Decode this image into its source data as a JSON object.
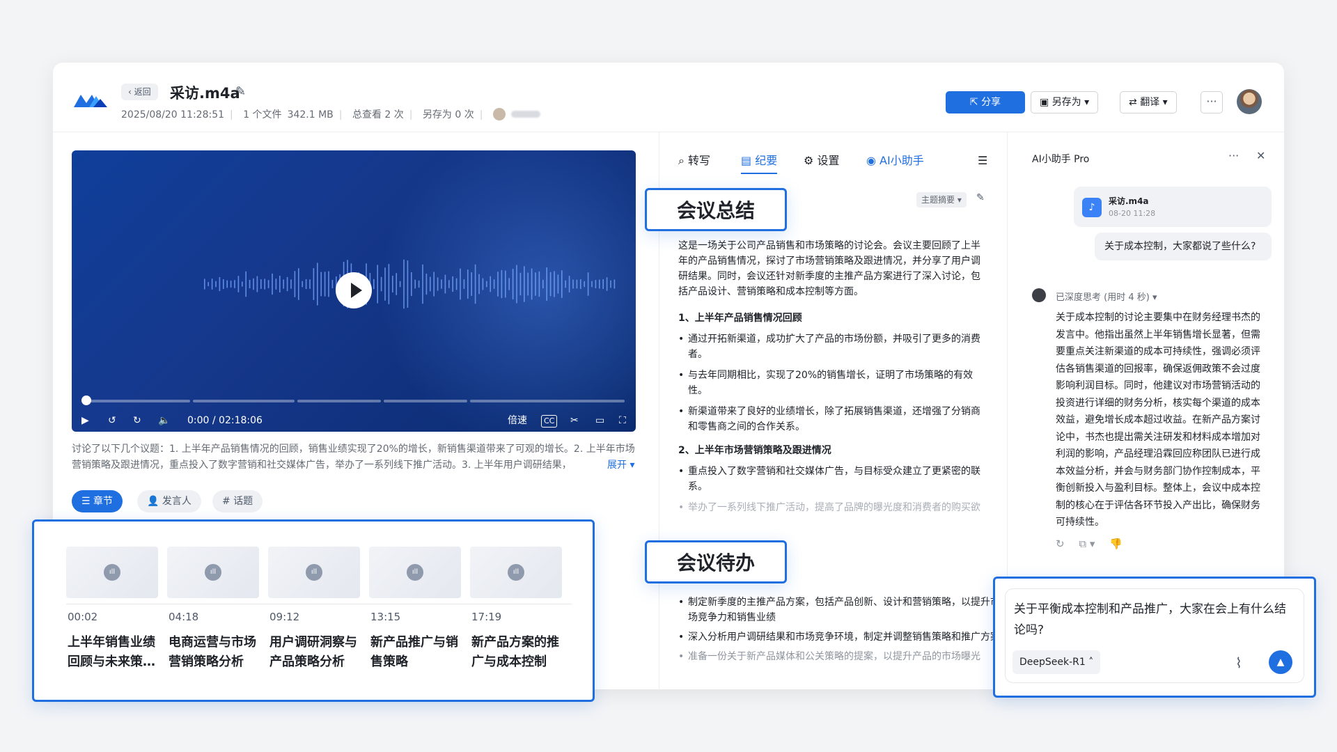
{
  "header": {
    "back_label": "返回",
    "file_title": "采访.m4a",
    "datetime": "2025/08/20 11:28:51",
    "file_count": "1 个文件",
    "file_size": "342.1 MB",
    "views": "总查看 2 次",
    "saves": "另存为 0 次",
    "share_label": "分享",
    "save_as_label": "另存为",
    "translate_label": "翻译",
    "more_label": "···"
  },
  "player": {
    "time_display": "0:00 / 02:18:06",
    "speed_label": "倍速",
    "cc_label": "CC"
  },
  "summary": {
    "text": "讨论了以下几个议题：1. 上半年产品销售情况的回顾，销售业绩实现了20%的增长，新销售渠道带来了可观的增长。2. 上半年市场营销策略及跟进情况，重点投入了数字营销和社交媒体广告，举办了一系列线下推广活动。3. 上半年用户调研结果，",
    "expand_label": "展开"
  },
  "left_tabs": {
    "chapters": "章节",
    "speakers": "发言人",
    "topics": "话题"
  },
  "chapters": [
    {
      "time": "00:02",
      "title": "上半年销售业绩回顾与未来策…"
    },
    {
      "time": "04:18",
      "title": "电商运营与市场营销策略分析"
    },
    {
      "time": "09:12",
      "title": "用户调研洞察与产品策略分析"
    },
    {
      "time": "13:15",
      "title": "新产品推广与销售策略"
    },
    {
      "time": "17:19",
      "title": "新产品方案的推广与成本控制"
    }
  ],
  "mid_tabs": {
    "transcribe": "转写",
    "minutes": "纪要",
    "settings": "设置",
    "ai": "AI小助手"
  },
  "minutes": {
    "topic_btn": "主题摘要",
    "callout_summary": "会议总结",
    "callout_todo": "会议待办",
    "intro": "这是一场关于公司产品销售和市场策略的讨论会。会议主要回顾了上半年的产品销售情况，探讨了市场营销策略及跟进情况，并分享了用户调研结果。同时，会议还针对新季度的主推产品方案进行了深入讨论，包括产品设计、营销策略和成本控制等方面。",
    "s1_title": "1、上半年产品销售情况回顾",
    "s1_items": [
      "通过开拓新渠道，成功扩大了产品的市场份额，并吸引了更多的消费者。",
      "与去年同期相比，实现了20%的销售增长，证明了市场策略的有效性。",
      "新渠道带来了良好的业绩增长，除了拓展销售渠道，还增强了分销商和零售商之间的合作关系。"
    ],
    "s2_title": "2、上半年市场营销策略及跟进情况",
    "s2_items": [
      "重点投入了数字营销和社交媒体广告，与目标受众建立了更紧密的联系。",
      "举办了一系列线下推广活动，提高了品牌的曝光度和消费者的购买欲"
    ],
    "todos": [
      "制定新季度的主推产品方案，包括产品创新、设计和营销策略，以提升市场竞争力和销售业绩",
      "深入分析用户调研结果和市场竞争环境，制定并调整销售策略和推广方案",
      "准备一份关于新产品媒体和公关策略的提案，以提升产品的市场曝光"
    ]
  },
  "ai_panel": {
    "title": "AI小助手 Pro",
    "file_name": "采访.m4a",
    "file_time": "08-20 11:28",
    "question": "关于成本控制，大家都说了些什么?",
    "think_label": "已深度思考 (用时 4 秒)",
    "answer": "关于成本控制的讨论主要集中在财务经理书杰的发言中。他指出虽然上半年销售增长显著，但需要重点关注新渠道的成本可持续性，强调必须评估各销售渠道的回报率，确保返佣政策不会过度影响利润目标。同时，他建议对市场营销活动的投资进行详细的财务分析，核实每个渠道的成本效益，避免增长成本超过收益。在新产品方案讨论中，书杰也提出需关注研发和材料成本增加对利润的影响，产品经理沿霖回应称团队已进行成本效益分析，并会与财务部门协作控制成本，平衡创新投入与盈利目标。整体上，会议中成本控制的核心在于评估各环节投入产出比，确保财务可持续性。",
    "input_text": "关于平衡成本控制和产品推广，大家在会上有什么结论吗?",
    "model_label": "DeepSeek-R1"
  },
  "colors": {
    "accent": "#1f6fe0",
    "video_bg": "#13398e"
  }
}
